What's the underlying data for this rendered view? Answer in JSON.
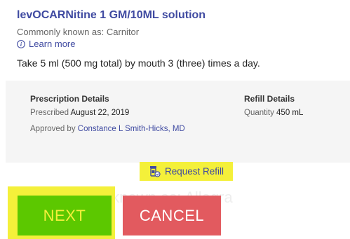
{
  "medication": {
    "name": "levOCARNitine 1 GM/10ML solution",
    "common_name": "Commonly known as: Carnitor",
    "learn_more": "Learn more",
    "sig": "Take 5 ml (500 mg total) by mouth 3 (three) times a day."
  },
  "prescription_details": {
    "heading": "Prescription Details",
    "prescribed_label": "Prescribed",
    "prescribed_date": "August 22, 2019",
    "approved_label": "Approved by",
    "approved_by": "Constance L Smith-Hicks, MD"
  },
  "refill_details": {
    "heading": "Refill Details",
    "quantity_label": "Quantity",
    "quantity_value": "450 mL"
  },
  "actions": {
    "request_refill": "Request Refill",
    "next": "NEXT",
    "cancel": "CANCEL"
  },
  "background_text": "Commonly known as: Allegra",
  "icons": {
    "learn_more": "info-icon",
    "request_refill": "pill-bottle-refill-icon"
  },
  "colors": {
    "link": "#3f4aa1",
    "highlight": "#f4f03a",
    "next": "#5cc800",
    "cancel": "#e25a5f",
    "panel": "#f5f5f5"
  }
}
